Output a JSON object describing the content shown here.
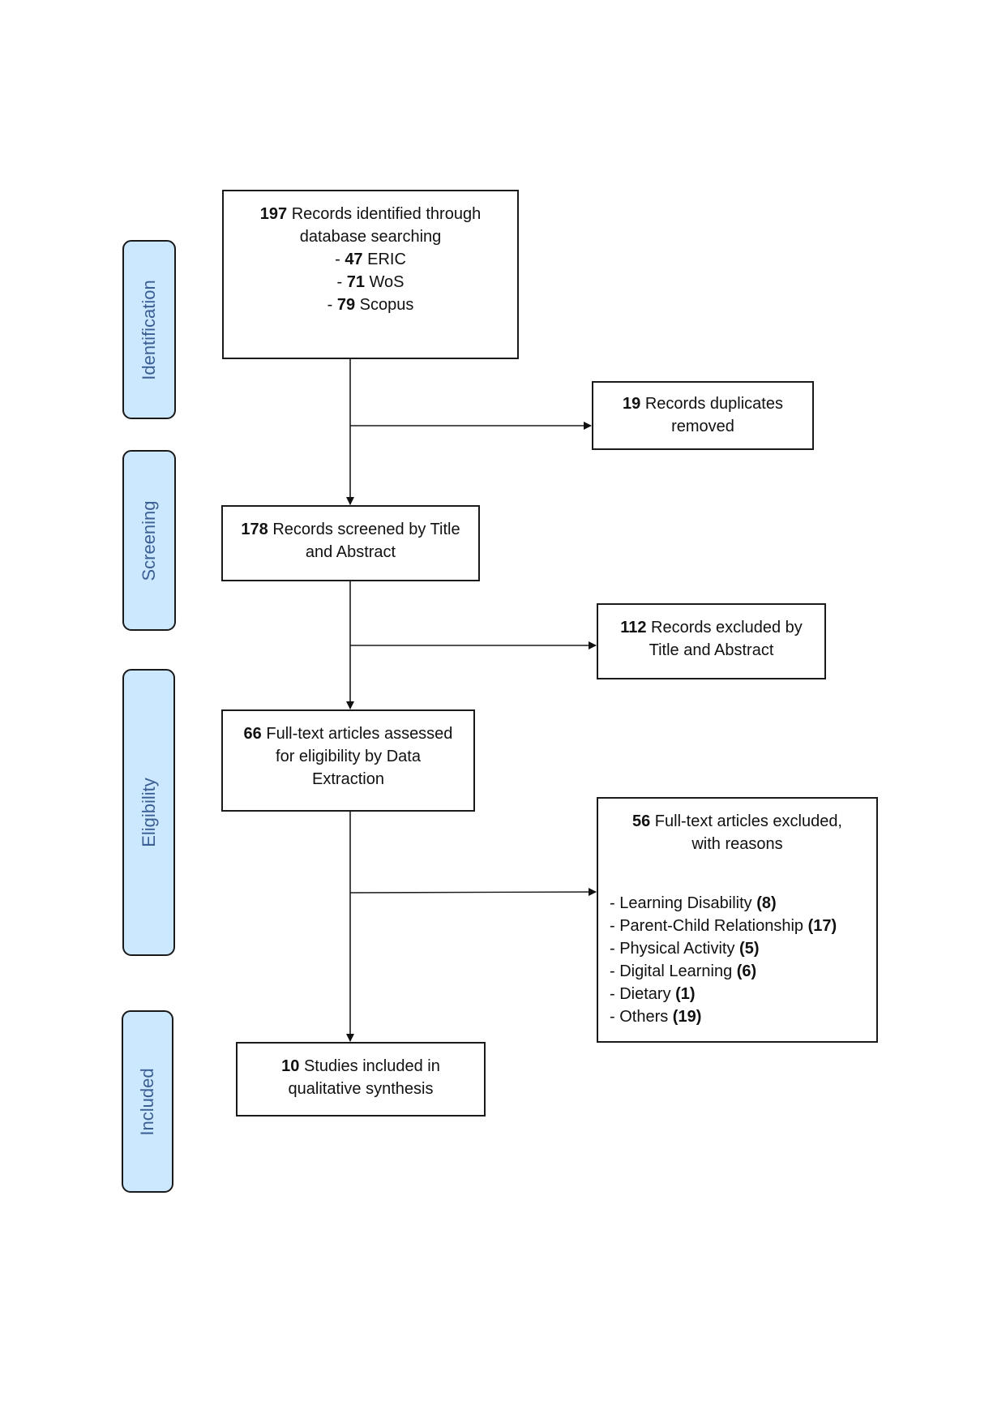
{
  "phases": [
    {
      "label": "Identification"
    },
    {
      "label": "Screening"
    },
    {
      "label": "Eligibility"
    },
    {
      "label": "Included"
    }
  ],
  "identification": {
    "count": "197",
    "text_1": " Records identified through",
    "text_2": "database searching",
    "sources": [
      {
        "prefix": "- ",
        "count": "47",
        "name": " ERIC"
      },
      {
        "prefix": "- ",
        "count": "71",
        "name": " WoS"
      },
      {
        "prefix": "- ",
        "count": "79",
        "name": " Scopus"
      }
    ]
  },
  "duplicates": {
    "count": "19",
    "text_1": " Records duplicates",
    "text_2": "removed"
  },
  "screening": {
    "count": "178",
    "text_1": " Records screened by Title",
    "text_2": "and Abstract"
  },
  "screen_excluded": {
    "count": "112",
    "text_1": " Records excluded by",
    "text_2": "Title and Abstract"
  },
  "eligibility": {
    "count": "66",
    "text_1": " Full-text articles assessed",
    "text_2": "for eligibility by Data",
    "text_3": "Extraction"
  },
  "fulltext_excluded": {
    "count": "56",
    "text_1": " Full-text articles excluded,",
    "text_2": "with reasons",
    "reasons": [
      {
        "label": "- Learning Disability ",
        "count": "(8)"
      },
      {
        "label": "- Parent-Child Relationship ",
        "count": "(17)"
      },
      {
        "label": "- Physical Activity ",
        "count": "(5)"
      },
      {
        "label": "- Digital Learning ",
        "count": "(6)"
      },
      {
        "label": "- Dietary ",
        "count": "(1)"
      },
      {
        "label": "- Others ",
        "count": "(19)"
      }
    ]
  },
  "included": {
    "count": "10",
    "text_1": " Studies included in",
    "text_2": "qualitative synthesis"
  },
  "colors": {
    "phase_fill": "#cce8ff",
    "phase_text": "#3b5f94",
    "line": "#1a1a1a"
  }
}
